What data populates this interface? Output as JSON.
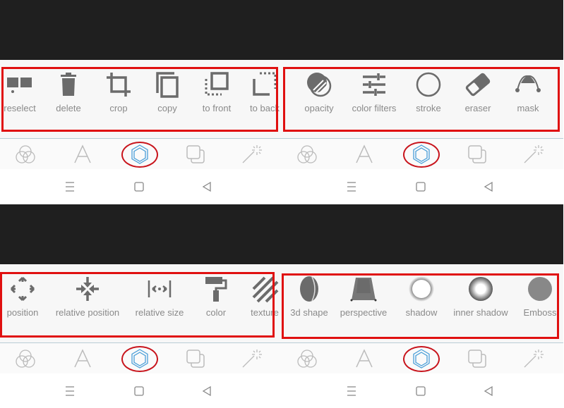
{
  "panels": [
    {
      "tools": [
        {
          "label": "reselect",
          "icon": "reselect-icon"
        },
        {
          "label": "delete",
          "icon": "trash-icon"
        },
        {
          "label": "crop",
          "icon": "crop-icon"
        },
        {
          "label": "copy",
          "icon": "copy-icon"
        },
        {
          "label": "to front",
          "icon": "bring-to-front-icon"
        },
        {
          "label": "to back",
          "icon": "send-to-back-icon"
        }
      ]
    },
    {
      "tools": [
        {
          "label": "opacity",
          "icon": "opacity-icon"
        },
        {
          "label": "color filters",
          "icon": "sliders-icon"
        },
        {
          "label": "stroke",
          "icon": "circle-outline-icon"
        },
        {
          "label": "eraser",
          "icon": "eraser-icon"
        },
        {
          "label": "mask",
          "icon": "mask-curve-icon"
        }
      ]
    },
    {
      "tools": [
        {
          "label": "position",
          "icon": "move-arrows-icon"
        },
        {
          "label": "relative position",
          "icon": "arrows-inward-icon"
        },
        {
          "label": "relative size",
          "icon": "width-arrows-icon"
        },
        {
          "label": "color",
          "icon": "paint-roller-icon"
        },
        {
          "label": "texture",
          "icon": "texture-stripes-icon"
        }
      ]
    },
    {
      "tools": [
        {
          "label": "3d shape",
          "icon": "3d-disc-icon"
        },
        {
          "label": "perspective",
          "icon": "perspective-icon"
        },
        {
          "label": "shadow",
          "icon": "shadow-circle-icon"
        },
        {
          "label": "inner shadow",
          "icon": "inner-shadow-circle-icon"
        },
        {
          "label": "Emboss",
          "icon": "emboss-circle-icon"
        }
      ]
    }
  ],
  "tabs": [
    {
      "icon": "color-circles-icon",
      "active": false
    },
    {
      "icon": "text-icon",
      "active": false
    },
    {
      "icon": "hexagon-shape-icon",
      "active": true
    },
    {
      "icon": "layers-icon",
      "active": false
    },
    {
      "icon": "magic-wand-icon",
      "active": false
    }
  ],
  "nav": [
    {
      "icon": "menu-icon"
    },
    {
      "icon": "home-square-icon"
    },
    {
      "icon": "back-triangle-icon"
    }
  ],
  "colors": {
    "highlight": "#e01010",
    "active_tab": "#4a9fd8",
    "icon": "#6b6b6b",
    "label": "#8a8a8a"
  }
}
